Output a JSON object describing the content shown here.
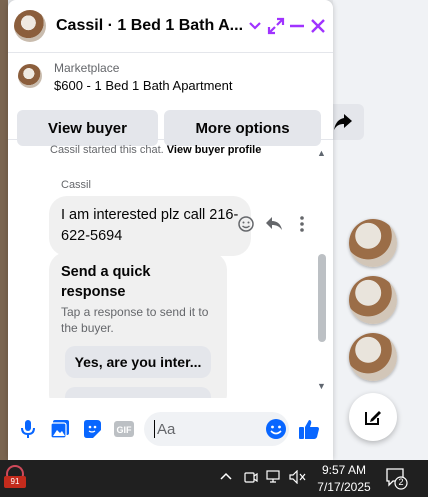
{
  "chat": {
    "title": "Cassil · 1 Bed 1 Bath A...",
    "listing_source": "Marketplace",
    "listing_title": "$600 - 1 Bed 1 Bath Apartment",
    "view_buyer": "View buyer",
    "more_options": "More options",
    "started_text": "Cassil started this chat.",
    "view_buyer_profile": "View buyer profile",
    "sender": "Cassil",
    "message": "I am interested plz call 216-622-5694",
    "quick_title": "Send a quick response",
    "quick_desc": "Tap a response to send it to the buyer.",
    "quick_option_1": "Yes, are you inter...",
    "input_placeholder": "Aa",
    "accent_color": "#a033ff"
  },
  "taskbar": {
    "app_badge": "91",
    "time": "9:57 AM",
    "date": "7/17/2025",
    "notification_count": "2"
  }
}
